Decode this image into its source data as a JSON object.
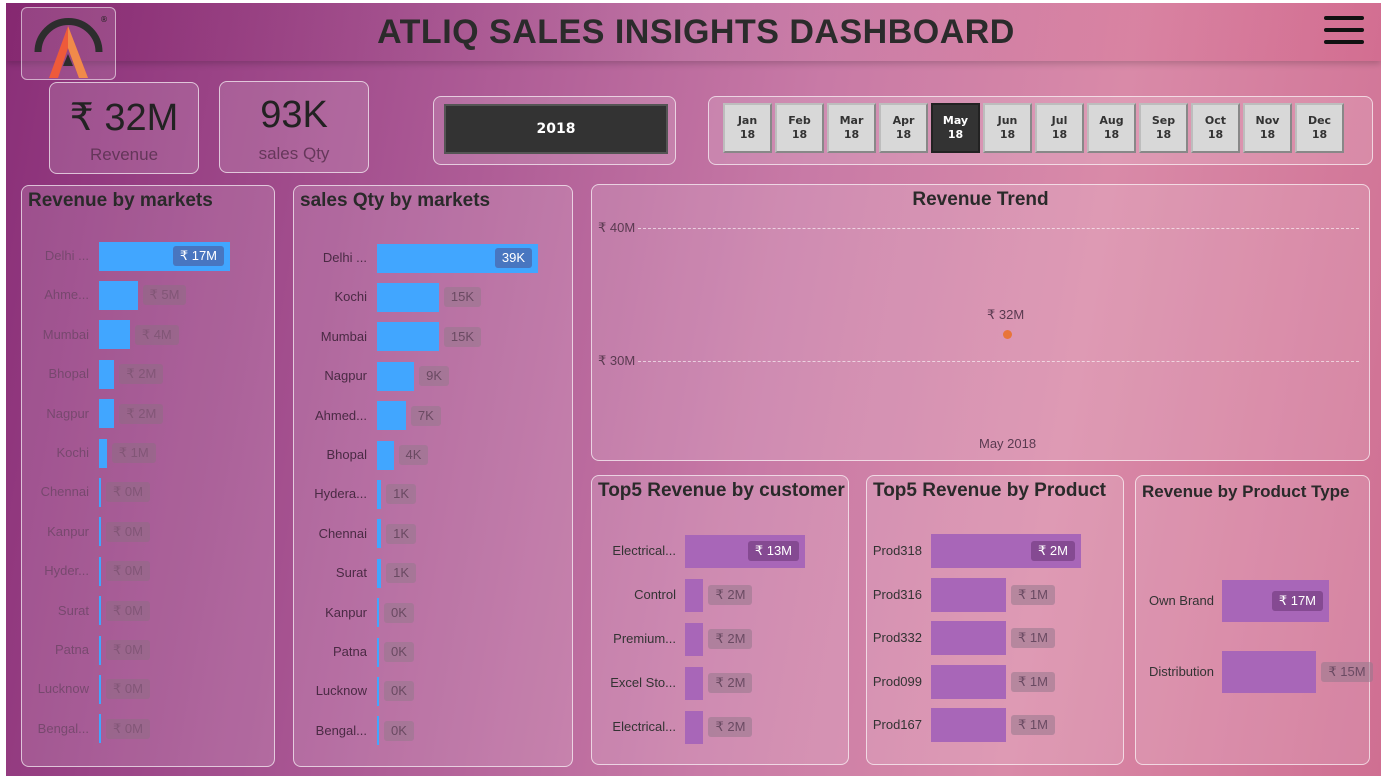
{
  "header": {
    "title": "ATLIQ SALES INSIGHTS DASHBOARD"
  },
  "kpis": {
    "revenue": {
      "value": "₹ 32M",
      "label": "Revenue"
    },
    "qty": {
      "value": "93K",
      "label": "sales Qty"
    }
  },
  "filters": {
    "year": "2018",
    "months": [
      {
        "m": "Jan",
        "y": "18"
      },
      {
        "m": "Feb",
        "y": "18"
      },
      {
        "m": "Mar",
        "y": "18"
      },
      {
        "m": "Apr",
        "y": "18"
      },
      {
        "m": "May",
        "y": "18"
      },
      {
        "m": "Jun",
        "y": "18"
      },
      {
        "m": "Jul",
        "y": "18"
      },
      {
        "m": "Aug",
        "y": "18"
      },
      {
        "m": "Sep",
        "y": "18"
      },
      {
        "m": "Oct",
        "y": "18"
      },
      {
        "m": "Nov",
        "y": "18"
      },
      {
        "m": "Dec",
        "y": "18"
      }
    ],
    "selected_month": "May"
  },
  "colors": {
    "bar_blue": "#41a6ff",
    "bar_purple": "#a866b8",
    "trend_point": "#e8753a",
    "selected_month_bg": "#333333"
  },
  "icons": {
    "logo": "atliq-logo-icon",
    "menu": "hamburger-menu-icon"
  },
  "chart_data": [
    {
      "type": "bar",
      "title": "Revenue by markets",
      "categories": [
        "Delhi ...",
        "Ahme...",
        "Mumbai",
        "Bhopal",
        "Nagpur",
        "Kochi",
        "Chennai",
        "Kanpur",
        "Hyder...",
        "Surat",
        "Patna",
        "Lucknow",
        "Bengal..."
      ],
      "values": [
        17,
        5,
        4,
        2,
        2,
        1,
        0,
        0,
        0,
        0,
        0,
        0,
        0
      ],
      "labels": [
        "₹ 17M",
        "₹ 5M",
        "₹ 4M",
        "₹ 2M",
        "₹ 2M",
        "₹ 1M",
        "₹ 0M",
        "₹ 0M",
        "₹ 0M",
        "₹ 0M",
        "₹ 0M",
        "₹ 0M",
        "₹ 0M"
      ]
    },
    {
      "type": "bar",
      "title": "sales Qty by markets",
      "categories": [
        "Delhi ...",
        "Kochi",
        "Mumbai",
        "Nagpur",
        "Ahmed...",
        "Bhopal",
        "Hydera...",
        "Chennai",
        "Surat",
        "Kanpur",
        "Patna",
        "Lucknow",
        "Bengal..."
      ],
      "values": [
        39,
        15,
        15,
        9,
        7,
        4,
        1,
        1,
        1,
        0,
        0,
        0,
        0
      ],
      "labels": [
        "39K",
        "15K",
        "15K",
        "9K",
        "7K",
        "4K",
        "1K",
        "1K",
        "1K",
        "0K",
        "0K",
        "0K",
        "0K"
      ]
    },
    {
      "type": "line",
      "title": "Revenue Trend",
      "x": [
        "May 2018"
      ],
      "y": [
        32
      ],
      "point_labels": [
        "₹ 32M"
      ],
      "y_ticks": [
        "₹ 40M",
        "₹ 30M"
      ],
      "ylim": [
        25,
        40
      ]
    },
    {
      "type": "bar",
      "title": "Top5 Revenue by customer",
      "categories": [
        "Electrical...",
        "Control",
        "Premium...",
        "Excel Sto...",
        "Electrical..."
      ],
      "values": [
        13,
        2,
        2,
        2,
        2
      ],
      "labels": [
        "₹ 13M",
        "₹ 2M",
        "₹ 2M",
        "₹ 2M",
        "₹ 2M"
      ]
    },
    {
      "type": "bar",
      "title": "Top5 Revenue by Product",
      "categories": [
        "Prod318",
        "Prod316",
        "Prod332",
        "Prod099",
        "Prod167"
      ],
      "values": [
        2,
        1,
        1,
        1,
        1
      ],
      "labels": [
        "₹ 2M",
        "₹ 1M",
        "₹ 1M",
        "₹ 1M",
        "₹ 1M"
      ]
    },
    {
      "type": "bar",
      "title": "Revenue by Product Type",
      "categories": [
        "Own Brand",
        "Distribution"
      ],
      "values": [
        17,
        15
      ],
      "labels": [
        "₹ 17M",
        "₹ 15M"
      ]
    }
  ]
}
